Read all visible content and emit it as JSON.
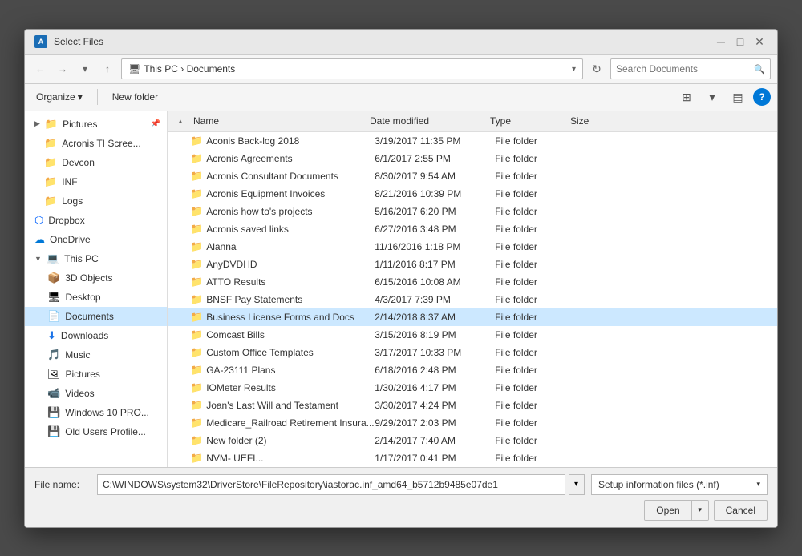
{
  "dialog": {
    "title": "Select Files",
    "title_icon": "A"
  },
  "address": {
    "path": "This PC  ›  Documents",
    "search_placeholder": "Search Documents",
    "path_parts": [
      "This PC",
      "Documents"
    ]
  },
  "toolbar": {
    "organize_label": "Organize",
    "new_folder_label": "New folder"
  },
  "columns": {
    "name": "Name",
    "date_modified": "Date modified",
    "type": "Type",
    "size": "Size"
  },
  "sidebar": {
    "items": [
      {
        "id": "pictures-pin",
        "label": "Pictures",
        "icon": "📁",
        "pinned": true
      },
      {
        "id": "acronis-ti",
        "label": "Acronis TI Scree...",
        "icon": "📁",
        "pinned": false
      },
      {
        "id": "devcon",
        "label": "Devcon",
        "icon": "📁",
        "pinned": false
      },
      {
        "id": "inf",
        "label": "INF",
        "icon": "📁",
        "pinned": false
      },
      {
        "id": "logs",
        "label": "Logs",
        "icon": "📁",
        "pinned": false
      },
      {
        "id": "dropbox",
        "label": "Dropbox",
        "icon": "🔵",
        "pinned": false
      },
      {
        "id": "onedrive",
        "label": "OneDrive",
        "icon": "☁",
        "pinned": false
      },
      {
        "id": "this-pc",
        "label": "This PC",
        "icon": "💻",
        "pinned": false
      },
      {
        "id": "3d-objects",
        "label": "3D Objects",
        "icon": "📦",
        "pinned": false,
        "indent": true
      },
      {
        "id": "desktop",
        "label": "Desktop",
        "icon": "🖥",
        "pinned": false,
        "indent": true
      },
      {
        "id": "documents",
        "label": "Documents",
        "icon": "📄",
        "pinned": false,
        "indent": true,
        "selected": true
      },
      {
        "id": "downloads",
        "label": "Downloads",
        "icon": "⬇",
        "pinned": false,
        "indent": true
      },
      {
        "id": "music",
        "label": "Music",
        "icon": "🎵",
        "pinned": false,
        "indent": true
      },
      {
        "id": "pictures2",
        "label": "Pictures",
        "icon": "🖼",
        "pinned": false,
        "indent": true
      },
      {
        "id": "videos",
        "label": "Videos",
        "icon": "📹",
        "pinned": false,
        "indent": true
      },
      {
        "id": "windows10",
        "label": "Windows 10 PRO",
        "icon": "💾",
        "pinned": false,
        "indent": true
      },
      {
        "id": "old-users",
        "label": "Old Users Profile...",
        "icon": "💾",
        "pinned": false,
        "indent": true
      }
    ]
  },
  "files": [
    {
      "name": "Aconis Back-log 2018",
      "date": "3/19/2017 11:35 PM",
      "type": "File folder",
      "size": ""
    },
    {
      "name": "Acronis Agreements",
      "date": "6/1/2017 2:55 PM",
      "type": "File folder",
      "size": ""
    },
    {
      "name": "Acronis Consultant Documents",
      "date": "8/30/2017 9:54 AM",
      "type": "File folder",
      "size": ""
    },
    {
      "name": "Acronis Equipment Invoices",
      "date": "8/21/2016 10:39 PM",
      "type": "File folder",
      "size": ""
    },
    {
      "name": "Acronis how to's projects",
      "date": "5/16/2017 6:20 PM",
      "type": "File folder",
      "size": ""
    },
    {
      "name": "Acronis saved links",
      "date": "6/27/2016 3:48 PM",
      "type": "File folder",
      "size": ""
    },
    {
      "name": "Alanna",
      "date": "11/16/2016 1:18 PM",
      "type": "File folder",
      "size": ""
    },
    {
      "name": "AnyDVDHD",
      "date": "1/11/2016 8:17 PM",
      "type": "File folder",
      "size": ""
    },
    {
      "name": "ATTO Results",
      "date": "6/15/2016 10:08 AM",
      "type": "File folder",
      "size": ""
    },
    {
      "name": "BNSF Pay Statements",
      "date": "4/3/2017 7:39 PM",
      "type": "File folder",
      "size": ""
    },
    {
      "name": "Business License Forms and Docs",
      "date": "2/14/2018 8:37 AM",
      "type": "File folder",
      "size": ""
    },
    {
      "name": "Comcast Bills",
      "date": "3/15/2016 8:19 PM",
      "type": "File folder",
      "size": ""
    },
    {
      "name": "Custom Office Templates",
      "date": "3/17/2017 10:33 PM",
      "type": "File folder",
      "size": ""
    },
    {
      "name": "GA-23111 Plans",
      "date": "6/18/2016 2:48 PM",
      "type": "File folder",
      "size": ""
    },
    {
      "name": "IOMeter Results",
      "date": "1/30/2016 4:17 PM",
      "type": "File folder",
      "size": ""
    },
    {
      "name": "Joan's Last Will and Testament",
      "date": "3/30/2017 4:24 PM",
      "type": "File folder",
      "size": ""
    },
    {
      "name": "Medicare_Railroad Retirement Insura...",
      "date": "9/29/2017 2:03 PM",
      "type": "File folder",
      "size": ""
    },
    {
      "name": "New folder (2)",
      "date": "2/14/2017 7:40 AM",
      "type": "File folder",
      "size": ""
    },
    {
      "name": "NVM- UEFI...",
      "date": "1/17/2017 0:41 PM",
      "type": "File folder",
      "size": ""
    }
  ],
  "bottom": {
    "filename_label": "File name:",
    "filename_value": "C:\\WINDOWS\\system32\\DriverStore\\FileRepository\\iastorac.inf_amd64_b5712b9485e07de1",
    "filetype_value": "Setup information files (*.inf)",
    "open_label": "Open",
    "cancel_label": "Cancel"
  }
}
